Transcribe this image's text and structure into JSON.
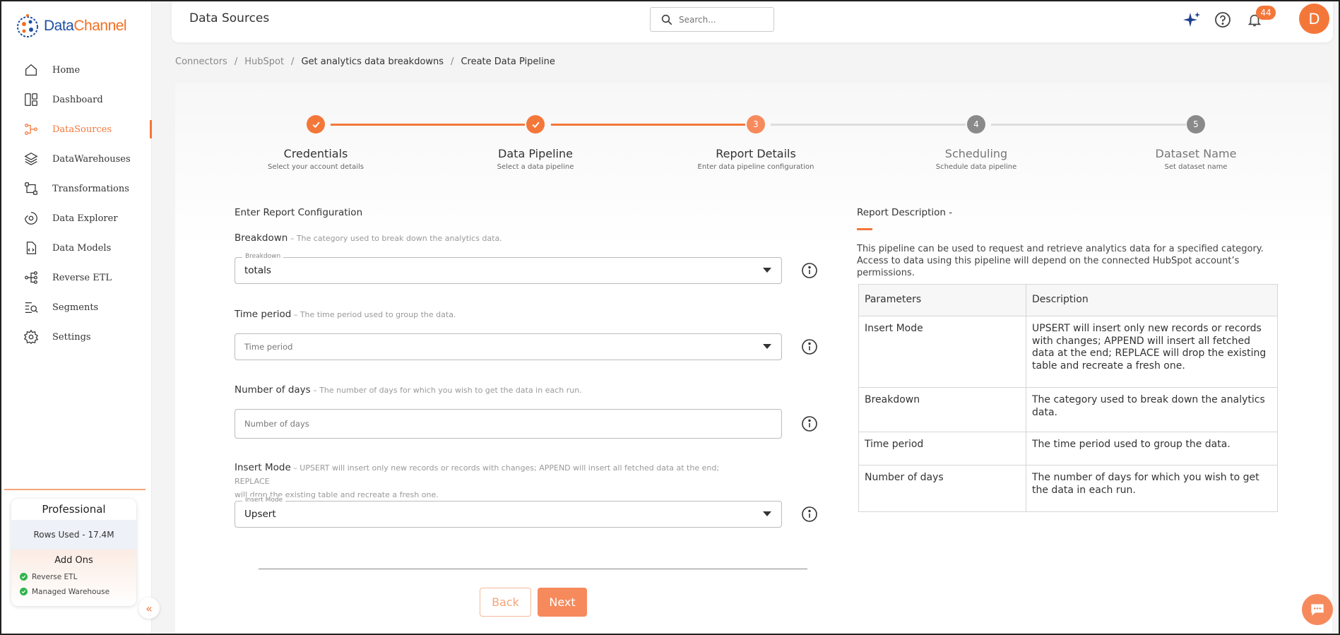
{
  "brand": {
    "name_part1": "Data",
    "name_part2": "Channel"
  },
  "sidebar": {
    "items": [
      {
        "label": "Home",
        "icon": "home-icon",
        "active": false
      },
      {
        "label": "Dashboard",
        "icon": "dashboard-icon",
        "active": false
      },
      {
        "label": "DataSources",
        "icon": "datasources-icon",
        "active": true
      },
      {
        "label": "DataWarehouses",
        "icon": "layers-icon",
        "active": false
      },
      {
        "label": "Transformations",
        "icon": "transformations-icon",
        "active": false
      },
      {
        "label": "Data Explorer",
        "icon": "explorer-icon",
        "active": false
      },
      {
        "label": "Data Models",
        "icon": "data-models-icon",
        "active": false
      },
      {
        "label": "Reverse ETL",
        "icon": "reverse-etl-icon",
        "active": false
      },
      {
        "label": "Segments",
        "icon": "segments-icon",
        "active": false
      },
      {
        "label": "Settings",
        "icon": "gear-icon",
        "active": false
      }
    ],
    "plan": {
      "title": "Professional",
      "rows_used": "Rows Used - 17.4M",
      "addons_title": "Add Ons",
      "addons": [
        "Reverse ETL",
        "Managed Warehouse"
      ]
    }
  },
  "header": {
    "title": "Data Sources",
    "search_placeholder": "Search...",
    "notification_count": "44",
    "avatar_initial": "D"
  },
  "breadcrumb": [
    "Connectors",
    "HubSpot",
    "Get analytics data breakdowns",
    "Create Data Pipeline"
  ],
  "stepper": {
    "current": 3,
    "steps": [
      {
        "title": "Credentials",
        "subtitle": "Select your account details",
        "state": "done",
        "number": "1"
      },
      {
        "title": "Data Pipeline",
        "subtitle": "Select a data pipeline",
        "state": "done",
        "number": "2"
      },
      {
        "title": "Report Details",
        "subtitle": "Enter data pipeline configuration",
        "state": "active",
        "number": "3"
      },
      {
        "title": "Scheduling",
        "subtitle": "Schedule data pipeline",
        "state": "pending",
        "number": "4"
      },
      {
        "title": "Dataset Name",
        "subtitle": "Set dataset name",
        "state": "pending",
        "number": "5"
      }
    ]
  },
  "form": {
    "section_title": "Enter Report Configuration",
    "breakdown": {
      "label": "Breakdown",
      "desc": " – The category used to break down the analytics data.",
      "float_label": "Breakdown",
      "value": "totals"
    },
    "time_period": {
      "label": "Time period",
      "desc": " – The time period used to group the data.",
      "placeholder": "Time period"
    },
    "num_days": {
      "label": "Number of days",
      "desc": " – The number of days for which you wish to get the data in each run.",
      "placeholder": "Number of days"
    },
    "insert_mode": {
      "label": "Insert Mode",
      "desc_line1": " – UPSERT will insert only new records or records with changes; APPEND will insert all fetched data at the end; REPLACE",
      "desc_line2": "will drop the existing table and recreate a fresh one.",
      "float_label": "Insert Mode",
      "value": "Upsert"
    },
    "back_label": "Back",
    "next_label": "Next"
  },
  "report": {
    "title": "Report Description -",
    "text": "This pipeline can be used to request and retrieve analytics data for a specified category. Access to data using this pipeline will depend on the connected HubSpot account’s permissions.",
    "table_headers": [
      "Parameters",
      "Description"
    ],
    "rows": [
      {
        "param": "Insert Mode",
        "desc": "UPSERT will insert only new records or records with changes; APPEND will insert all fetched data at the end; REPLACE will drop the existing table and recreate a fresh one."
      },
      {
        "param": "Breakdown",
        "desc": "The category used to break down the analytics data."
      },
      {
        "param": "Time period",
        "desc": "The time period used to group the data."
      },
      {
        "param": "Number of days",
        "desc": "The number of days for which you wish to get the data in each run."
      }
    ]
  },
  "colors": {
    "accent": "#f4773a",
    "accent_light": "#f68a5c",
    "done_line": "#f4773a",
    "pending_line": "#dddddd",
    "pending_circle": "#8a8a8a"
  }
}
